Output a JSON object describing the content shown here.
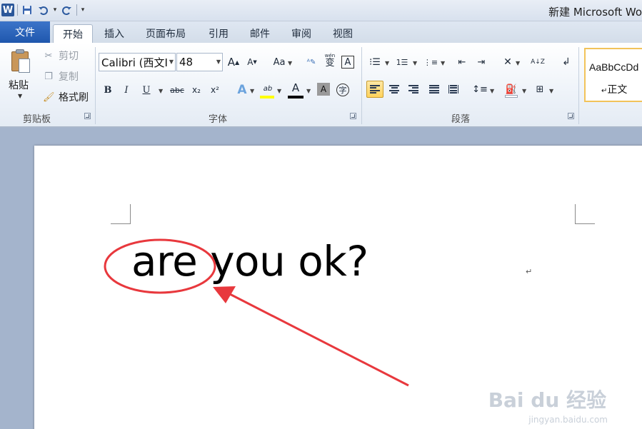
{
  "window": {
    "title": "新建 Microsoft Wo"
  },
  "quick_access": {
    "app_icon": "W",
    "save_icon": "save-icon",
    "undo_icon": "undo-icon",
    "redo_icon": "redo-icon"
  },
  "tabs": {
    "file": "文件",
    "items": [
      "开始",
      "插入",
      "页面布局",
      "引用",
      "邮件",
      "审阅",
      "视图"
    ],
    "active": "开始"
  },
  "clipboard": {
    "paste": "粘贴",
    "cut": "剪切",
    "copy": "复制",
    "format_painter": "格式刷",
    "group_label": "剪贴板"
  },
  "font": {
    "family": "Calibri (西文I",
    "size": "48",
    "grow_glyph": "A",
    "shrink_glyph": "A",
    "case_glyph": "Aa",
    "phonetic_glyph": "wén",
    "phonetic_char": "变",
    "border_glyph": "A",
    "bold": "B",
    "italic": "I",
    "underline": "U",
    "strike": "abc",
    "subscript": "x₂",
    "superscript": "x²",
    "highlight_glyph": "ab",
    "color_glyph": "A",
    "shade_glyph": "A",
    "enclose_glyph": "字",
    "group_label": "字体",
    "highlight_color": "#ffff00",
    "font_color": "#000000"
  },
  "paragraph": {
    "sort_glyph": "A↓Z",
    "group_label": "段落"
  },
  "styles": {
    "sample": "AaBbCcDd",
    "name": "正文",
    "pilcrow": "↵"
  },
  "document": {
    "text": "are you ok?",
    "para_mark": "↵"
  },
  "watermark": {
    "brand": "Bai du 经验",
    "url": "jingyan.baidu.com"
  },
  "colors": {
    "accent": "#2b579a",
    "annotation": "#e8383d",
    "highlight_active": "#ffd35c"
  }
}
